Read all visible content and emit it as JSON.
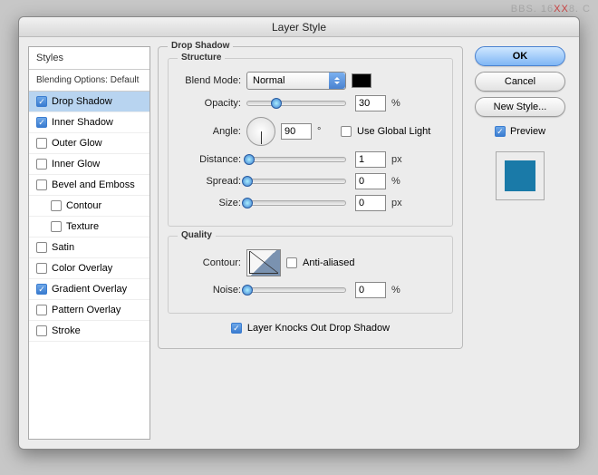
{
  "watermark": {
    "prefix": "BBS. 16",
    "mid": "XX",
    "suffix": "8. C"
  },
  "window_title": "Layer Style",
  "styles": {
    "header": "Styles",
    "subtitle": "Blending Options: Default",
    "items": [
      {
        "label": "Drop Shadow",
        "checked": true,
        "selected": true,
        "indent": false
      },
      {
        "label": "Inner Shadow",
        "checked": true,
        "selected": false,
        "indent": false
      },
      {
        "label": "Outer Glow",
        "checked": false,
        "selected": false,
        "indent": false
      },
      {
        "label": "Inner Glow",
        "checked": false,
        "selected": false,
        "indent": false
      },
      {
        "label": "Bevel and Emboss",
        "checked": false,
        "selected": false,
        "indent": false
      },
      {
        "label": "Contour",
        "checked": false,
        "selected": false,
        "indent": true
      },
      {
        "label": "Texture",
        "checked": false,
        "selected": false,
        "indent": true
      },
      {
        "label": "Satin",
        "checked": false,
        "selected": false,
        "indent": false
      },
      {
        "label": "Color Overlay",
        "checked": false,
        "selected": false,
        "indent": false
      },
      {
        "label": "Gradient Overlay",
        "checked": true,
        "selected": false,
        "indent": false
      },
      {
        "label": "Pattern Overlay",
        "checked": false,
        "selected": false,
        "indent": false
      },
      {
        "label": "Stroke",
        "checked": false,
        "selected": false,
        "indent": false
      }
    ]
  },
  "panel": {
    "title": "Drop Shadow",
    "structure": {
      "legend": "Structure",
      "blend_mode_label": "Blend Mode:",
      "blend_mode_value": "Normal",
      "color": "#000000",
      "opacity_label": "Opacity:",
      "opacity_value": "30",
      "opacity_unit": "%",
      "angle_label": "Angle:",
      "angle_value": "90",
      "angle_unit": "°",
      "global_light_label": "Use Global Light",
      "global_light_checked": false,
      "distance_label": "Distance:",
      "distance_value": "1",
      "distance_unit": "px",
      "spread_label": "Spread:",
      "spread_value": "0",
      "spread_unit": "%",
      "size_label": "Size:",
      "size_value": "0",
      "size_unit": "px"
    },
    "quality": {
      "legend": "Quality",
      "contour_label": "Contour:",
      "anti_aliased_label": "Anti-aliased",
      "anti_aliased_checked": false,
      "noise_label": "Noise:",
      "noise_value": "0",
      "noise_unit": "%"
    },
    "knockout_label": "Layer Knocks Out Drop Shadow",
    "knockout_checked": true
  },
  "buttons": {
    "ok": "OK",
    "cancel": "Cancel",
    "new_style": "New Style..."
  },
  "preview": {
    "label": "Preview",
    "checked": true,
    "color": "#1a7aa8"
  }
}
